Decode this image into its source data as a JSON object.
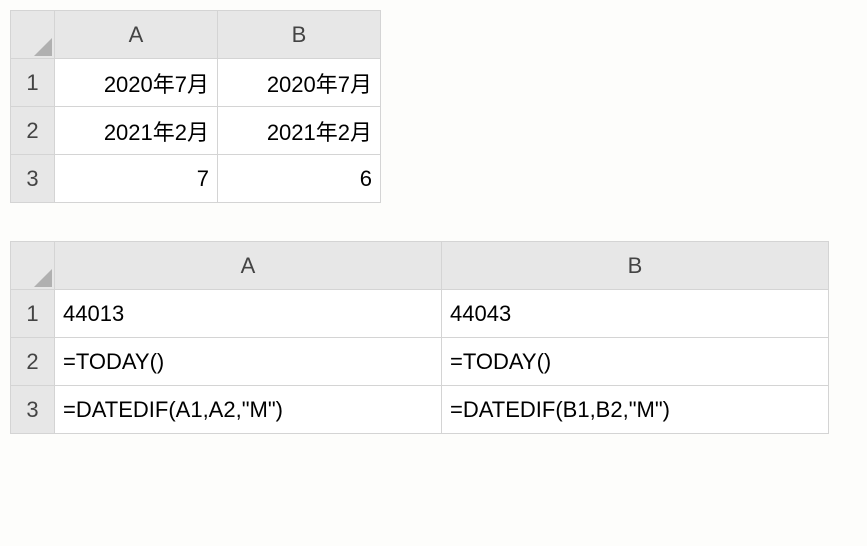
{
  "table1": {
    "colA": "A",
    "colB": "B",
    "row1": "1",
    "row2": "2",
    "row3": "3",
    "cells": {
      "A1": "2020年7月",
      "B1": "2020年7月",
      "A2": "2021年2月",
      "B2": "2021年2月",
      "A3": "7",
      "B3": "6"
    }
  },
  "table2": {
    "colA": "A",
    "colB": "B",
    "row1": "1",
    "row2": "2",
    "row3": "3",
    "cells": {
      "A1": "44013",
      "B1": "44043",
      "A2": "=TODAY()",
      "B2": "=TODAY()",
      "A3": "=DATEDIF(A1,A2,\"M\")",
      "B3": "=DATEDIF(B1,B2,\"M\")"
    }
  }
}
